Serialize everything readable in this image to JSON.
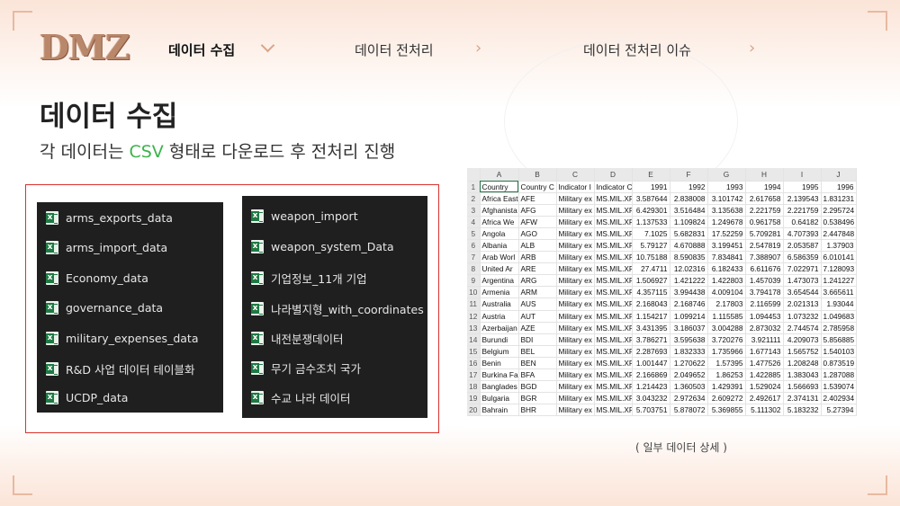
{
  "logo": "DMZ",
  "nav": {
    "items": [
      "데이터 수집",
      "데이터 전처리",
      "데이터 전처리 이슈"
    ]
  },
  "page": {
    "title": "데이터 수집",
    "subtitle_pre": "각 데이터는 ",
    "subtitle_csv": "CSV",
    "subtitle_post": " 형태로 다운로드 후 전처리 진행",
    "caption": "( 일부 데이터 상세 )"
  },
  "files_left": [
    "arms_exports_data",
    "arms_import_data",
    "Economy_data",
    "governance_data",
    "military_expenses_data",
    "R&D 사업 데이터 테이블화",
    "UCDP_data"
  ],
  "files_right": [
    "weapon_import",
    "weapon_system_Data",
    "기업정보_11개 기업",
    "나라별지형_with_coordinates",
    "내전분쟁데이터",
    "무기 금수조치 국가",
    "수교 나라 데이터"
  ],
  "spreadsheet": {
    "columns": [
      "A",
      "B",
      "C",
      "D",
      "E",
      "F",
      "G",
      "H",
      "I",
      "J"
    ],
    "header": [
      "Country",
      "Country C",
      "Indicator I",
      "Indicator C",
      "1991",
      "1992",
      "1993",
      "1994",
      "1995",
      "1996"
    ],
    "rows": [
      [
        "Africa East",
        "AFE",
        "Military ex",
        "MS.MIL.XF",
        "3.587644",
        "2.838008",
        "3.101742",
        "2.617658",
        "2.139543",
        "1.831231"
      ],
      [
        "Afghanista",
        "AFG",
        "Military ex",
        "MS.MIL.XF",
        "6.429301",
        "3.516484",
        "3.135638",
        "2.221759",
        "2.221759",
        "2.295724"
      ],
      [
        "Africa We",
        "AFW",
        "Military ex",
        "MS.MIL.XF",
        "1.137533",
        "1.109824",
        "1.249678",
        "0.961758",
        "0.64182",
        "0.538496"
      ],
      [
        "Angola",
        "AGO",
        "Military ex",
        "MS.MIL.XF",
        "7.1025",
        "5.682831",
        "17.52259",
        "5.709281",
        "4.707393",
        "2.447848"
      ],
      [
        "Albania",
        "ALB",
        "Military ex",
        "MS.MIL.XF",
        "5.79127",
        "4.670888",
        "3.199451",
        "2.547819",
        "2.053587",
        "1.37903"
      ],
      [
        "Arab Worl",
        "ARB",
        "Military ex",
        "MS.MIL.XF",
        "10.75188",
        "8.590835",
        "7.834841",
        "7.388907",
        "6.586359",
        "6.010141"
      ],
      [
        "United Ar",
        "ARE",
        "Military ex",
        "MS.MIL.XF",
        "27.4711",
        "12.02316",
        "6.182433",
        "6.611676",
        "7.022971",
        "7.128093"
      ],
      [
        "Argentina",
        "ARG",
        "Military ex",
        "MS.MIL.XF",
        "1.506927",
        "1.421222",
        "1.422803",
        "1.457039",
        "1.473073",
        "1.241227"
      ],
      [
        "Armenia",
        "ARM",
        "Military ex",
        "MS.MIL.XF",
        "4.357115",
        "3.994438",
        "4.009104",
        "3.794178",
        "3.654544",
        "3.665611"
      ],
      [
        "Australia",
        "AUS",
        "Military ex",
        "MS.MIL.XF",
        "2.168043",
        "2.168746",
        "2.17803",
        "2.116599",
        "2.021313",
        "1.93044"
      ],
      [
        "Austria",
        "AUT",
        "Military ex",
        "MS.MIL.XF",
        "1.154217",
        "1.099214",
        "1.115585",
        "1.094453",
        "1.073232",
        "1.049683"
      ],
      [
        "Azerbaijan",
        "AZE",
        "Military ex",
        "MS.MIL.XF",
        "3.431395",
        "3.186037",
        "3.004288",
        "2.873032",
        "2.744574",
        "2.785958"
      ],
      [
        "Burundi",
        "BDI",
        "Military ex",
        "MS.MIL.XF",
        "3.786271",
        "3.595638",
        "3.720276",
        "3.921111",
        "4.209073",
        "5.856885"
      ],
      [
        "Belgium",
        "BEL",
        "Military ex",
        "MS.MIL.XF",
        "2.287693",
        "1.832333",
        "1.735966",
        "1.677143",
        "1.565752",
        "1.540103"
      ],
      [
        "Benin",
        "BEN",
        "Military ex",
        "MS.MIL.XF",
        "1.001447",
        "1.270622",
        "1.57395",
        "1.477526",
        "1.208248",
        "0.873519"
      ],
      [
        "Burkina Fa",
        "BFA",
        "Military ex",
        "MS.MIL.XF",
        "2.166869",
        "2.049652",
        "1.86253",
        "1.422885",
        "1.383043",
        "1.287088"
      ],
      [
        "Banglades",
        "BGD",
        "Military ex",
        "MS.MIL.XF",
        "1.214423",
        "1.360503",
        "1.429391",
        "1.529024",
        "1.566693",
        "1.539074"
      ],
      [
        "Bulgaria",
        "BGR",
        "Military ex",
        "MS.MIL.XF",
        "3.043232",
        "2.972634",
        "2.609272",
        "2.492617",
        "2.374131",
        "2.402934"
      ],
      [
        "Bahrain",
        "BHR",
        "Military ex",
        "MS.MIL.XF",
        "5.703751",
        "5.878072",
        "5.369855",
        "5.111302",
        "5.183232",
        "5.27394"
      ]
    ]
  }
}
